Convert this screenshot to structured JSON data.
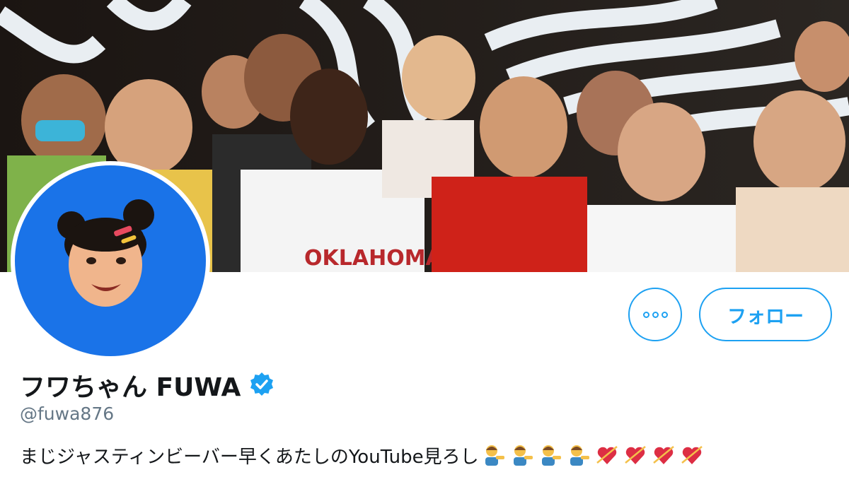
{
  "profile": {
    "display_name": "フワちゃん FUWA",
    "handle": "@fuwa876",
    "bio": "まじジャスティンビーバー早くあたしのYouTube見ろし",
    "bio_emojis": [
      "person-tipping-hand-icon",
      "person-tipping-hand-icon",
      "person-tipping-hand-icon",
      "person-tipping-hand-icon",
      "heart-with-arrow-icon",
      "heart-with-arrow-icon",
      "heart-with-arrow-icon",
      "heart-with-arrow-icon"
    ],
    "verified": true
  },
  "actions": {
    "more_icon": "more-options-icon",
    "follow_label": "フォロー"
  },
  "colors": {
    "accent": "#1da1f2",
    "avatar_bg": "#1a73e8",
    "text": "#14171a",
    "muted": "#657786"
  }
}
